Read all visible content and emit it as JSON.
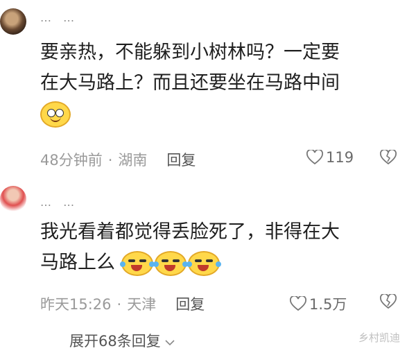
{
  "comments": [
    {
      "username": "… …",
      "lines": [
        "要亲热，不能躲到小树林吗？一定要",
        "在大马路上？而且还要坐在马路中间"
      ],
      "emoji": [
        "smile-emoji"
      ],
      "time": "48分钟前",
      "location": "湖南",
      "reply_label": "回复",
      "likes": "119"
    },
    {
      "username": "… …",
      "lines": [
        "我光看着都觉得丢脸死了，非得在大",
        "马路上么"
      ],
      "emoji": [
        "laugh-cry-emoji",
        "laugh-cry-emoji",
        "laugh-cry-emoji"
      ],
      "time": "昨天15:26",
      "location": "天津",
      "reply_label": "回复",
      "likes": "1.5万"
    }
  ],
  "separator": "·",
  "expand_label": "展开68条回复",
  "watermark": "乡村凯迪",
  "colors": {
    "text": "#1f1f1f",
    "meta": "#9a9a9a",
    "emoji": "#ffd84a"
  }
}
